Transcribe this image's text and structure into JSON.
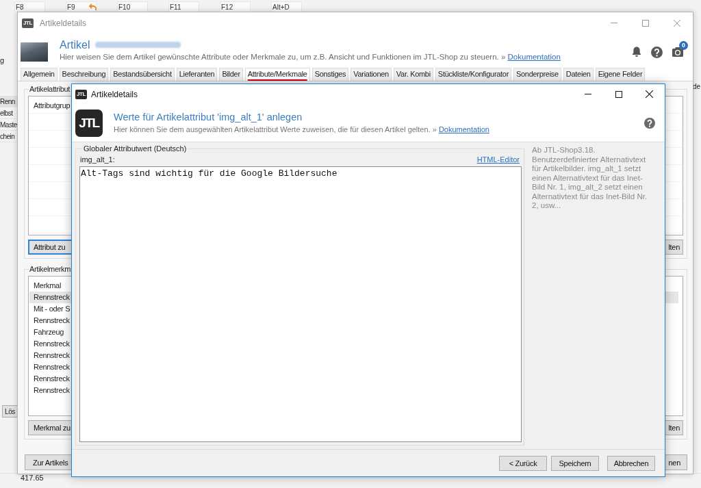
{
  "background_app": {
    "toolbar_keys": [
      {
        "label": "F8",
        "kind": "plain"
      },
      {
        "label": "F9",
        "kind": "with_icon"
      },
      {
        "label": "F10",
        "kind": "plain"
      },
      {
        "label": "F11",
        "kind": "plain"
      },
      {
        "label": "F12",
        "kind": "plain"
      },
      {
        "label": "Alt+D",
        "kind": "plain"
      }
    ],
    "side_text": "g",
    "list_rows": [
      {
        "label": "Renn",
        "selected": true
      },
      {
        "label": "elbst",
        "selected": false
      },
      {
        "label": "Maste",
        "selected": false
      },
      {
        "label": "chein",
        "selected": false
      }
    ],
    "delete_button": "Lös",
    "edge_text": "de",
    "bottom_value": "417.65"
  },
  "main_window": {
    "title": "Artikeldetails",
    "app_icon": "JTL",
    "active": false,
    "header": {
      "title": "Artikel",
      "name_blurred": true,
      "subtitle": "Hier weisen Sie dem Artikel gewünschte Attribute oder Merkmale zu, um z.B. Ansicht und Funktionen im JTL-Shop zu steuern. »",
      "link": "Dokumentation",
      "notification_count": "0"
    },
    "tabs": [
      {
        "label": "Allgemein",
        "selected": false
      },
      {
        "label": "Beschreibung",
        "selected": false
      },
      {
        "label": "Bestandsübersicht",
        "selected": false
      },
      {
        "label": "Lieferanten",
        "selected": false
      },
      {
        "label": "Bilder",
        "selected": false
      },
      {
        "label": "Attribute/Merkmale",
        "selected": true
      },
      {
        "label": "Sonstiges",
        "selected": false
      },
      {
        "label": "Variationen",
        "selected": false
      },
      {
        "label": "Var. Kombi",
        "selected": false
      },
      {
        "label": "Stückliste/Konfigurator",
        "selected": false
      },
      {
        "label": "Sonderpreise",
        "selected": false
      },
      {
        "label": "Dateien",
        "selected": false
      },
      {
        "label": "Eigene Felder",
        "selected": false
      }
    ],
    "attribute_group": {
      "label": "Artikelattribut",
      "column": "Attributgrup",
      "add_button": "Attribut zu",
      "add_button_focused": true,
      "right_button": "lten"
    },
    "feature_group": {
      "label": "Artikelmerkm",
      "column": "Merkmal",
      "rows": [
        {
          "label": "Rennstreck",
          "selected": true
        },
        {
          "label": "Mit - oder S",
          "selected": false
        },
        {
          "label": "Rennstreck",
          "selected": false
        },
        {
          "label": "Fahrzeug",
          "selected": false
        },
        {
          "label": "Rennstreck",
          "selected": false
        },
        {
          "label": "Rennstreck",
          "selected": false
        },
        {
          "label": "Rennstreck",
          "selected": false
        },
        {
          "label": "Rennstreck",
          "selected": false
        },
        {
          "label": "Rennstreck",
          "selected": false
        }
      ],
      "add_button": "Merkmal zu",
      "right_button": "lten"
    },
    "footer": {
      "left_button": "Zur Artikels",
      "right_button": "nen"
    }
  },
  "dialog": {
    "title": "Artikeldetails",
    "app_icon": "JTL",
    "active": true,
    "logo": "JTL",
    "header": {
      "title": "Werte für Artikelattribut 'img_alt_1' anlegen",
      "subtitle": "Hier können Sie dem ausgewählten Artikelattribut Werte zuweisen, die für diesen Artikel gelten. »",
      "link": "Dokumentation"
    },
    "group_label": "Globaler Attributwert (Deutsch)",
    "field_label": "img_alt_1:",
    "editor_link": "HTML-Editor",
    "value": "Alt-Tags sind wichtig für die Google Bildersuche",
    "help_text": "Ab JTL-Shop3.18. Benutzerdefinierter Alternativtext für Artikelbilder. img_alt_1 setzt einen Alternativtext für das Inet-Bild Nr. 1, img_alt_2 setzt einen Alternativtext für das Inet-Bild Nr. 2, usw...",
    "buttons": [
      "< Zurück",
      "Speichern",
      "Abbrechen"
    ]
  }
}
